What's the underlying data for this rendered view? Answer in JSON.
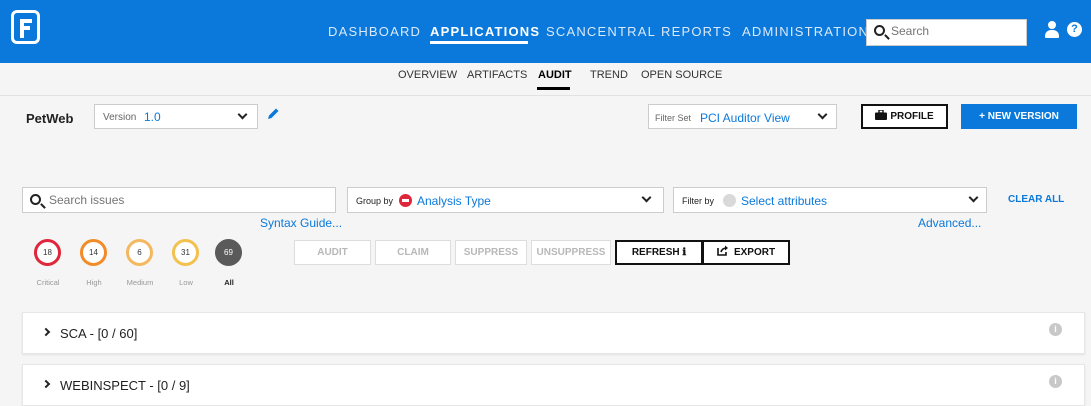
{
  "topnav": {
    "items": [
      {
        "label": "DASHBOARD",
        "active": false
      },
      {
        "label": "APPLICATIONS",
        "active": true
      },
      {
        "label": "SCANCENTRAL",
        "active": false
      },
      {
        "label": "REPORTS",
        "active": false
      },
      {
        "label": "ADMINISTRATION",
        "active": false
      }
    ],
    "search_placeholder": "Search"
  },
  "subnav": {
    "items": [
      {
        "label": "OVERVIEW",
        "active": false
      },
      {
        "label": "ARTIFACTS",
        "active": false
      },
      {
        "label": "AUDIT",
        "active": true
      },
      {
        "label": "TREND",
        "active": false
      },
      {
        "label": "OPEN SOURCE",
        "active": false
      }
    ]
  },
  "app": {
    "name": "PetWeb",
    "version_label": "Version",
    "version_value": "1.0",
    "filterset_label": "Filter Set",
    "filterset_value": "PCI Auditor View",
    "profile_label": "PROFILE",
    "new_version_label": "+ NEW VERSION"
  },
  "filters": {
    "search_placeholder": "Search issues",
    "syntax_link": "Syntax Guide...",
    "groupby_label": "Group by",
    "groupby_value": "Analysis Type",
    "filterby_label": "Filter by",
    "filterby_value": "Select attributes",
    "clear_all": "CLEAR ALL",
    "advanced_link": "Advanced..."
  },
  "severity": [
    {
      "count": "18",
      "label": "Critical",
      "color": "#e0263a"
    },
    {
      "count": "14",
      "label": "High",
      "color": "#f28c28"
    },
    {
      "count": "6",
      "label": "Medium",
      "color": "#f4b860"
    },
    {
      "count": "31",
      "label": "Low",
      "color": "#f2c14e"
    },
    {
      "count": "69",
      "label": "All",
      "color": "#5a5a5a"
    }
  ],
  "actions": {
    "audit": "AUDIT",
    "claim": "CLAIM",
    "suppress": "SUPPRESS",
    "unsuppress": "UNSUPPRESS",
    "refresh": "REFRESH ℹ",
    "export": "EXPORT"
  },
  "groups": [
    {
      "title": "SCA - [0 / 60]"
    },
    {
      "title": "WEBINSPECT - [0 / 9]"
    }
  ],
  "colors": {
    "brand_blue": "#0a79db",
    "critical_red": "#e0263a"
  }
}
